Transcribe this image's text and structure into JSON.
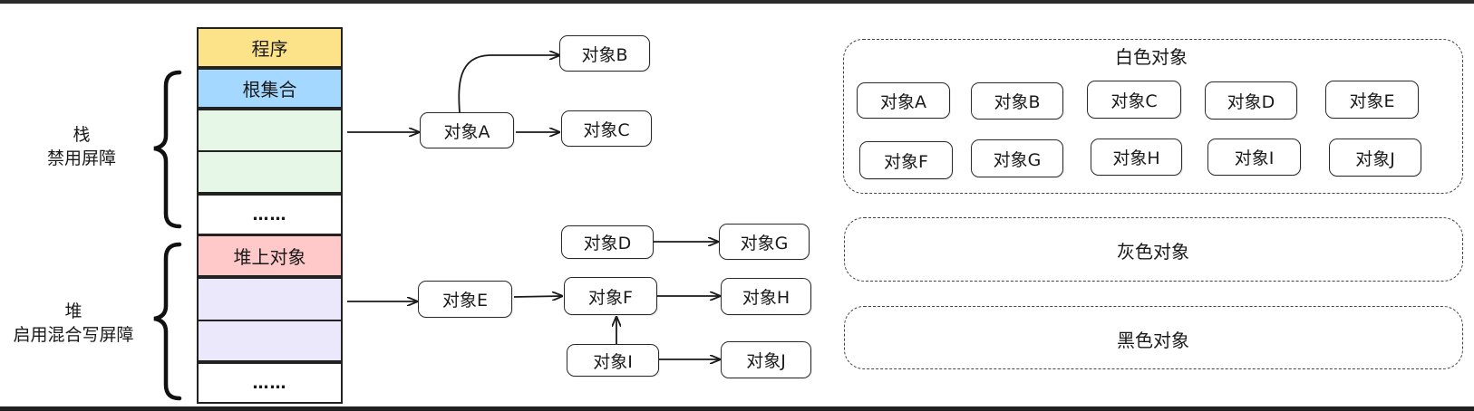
{
  "stack": {
    "program_label": "程序",
    "root_set_label": "根集合",
    "more_label": "……",
    "side_title": "栈",
    "side_subtitle": "禁用屏障"
  },
  "heap": {
    "heap_object_label": "堆上对象",
    "more_label": "……",
    "side_title": "堆",
    "side_subtitle": "启用混合写屏障"
  },
  "nodes": {
    "A": "对象A",
    "B": "对象B",
    "C": "对象C",
    "D": "对象D",
    "E": "对象E",
    "F": "对象F",
    "G": "对象G",
    "H": "对象H",
    "I": "对象I",
    "J": "对象J"
  },
  "panels": {
    "white": {
      "title": "白色对象",
      "items": [
        "对象A",
        "对象B",
        "对象C",
        "对象D",
        "对象E",
        "对象F",
        "对象G",
        "对象H",
        "对象I",
        "对象J"
      ]
    },
    "gray": {
      "title": "灰色对象"
    },
    "black": {
      "title": "黑色对象"
    }
  },
  "colors": {
    "program": "#fce38a",
    "root_set": "#a5d8ff",
    "stack_frame": "#e6f7e8",
    "heap_object": "#ffc9c9",
    "heap_frame": "#ece8fb",
    "stroke": "#222222"
  }
}
